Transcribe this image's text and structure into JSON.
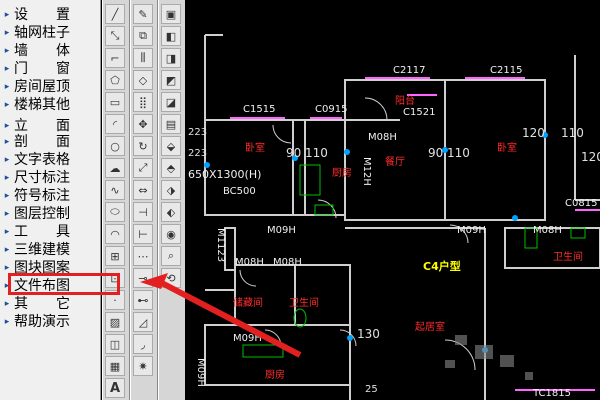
{
  "menu": {
    "items": [
      {
        "label": "设　　置",
        "arrow": "▸"
      },
      {
        "label": "轴网柱子",
        "arrow": "▸"
      },
      {
        "label": "墙　　体",
        "arrow": "▸"
      },
      {
        "label": "门　　窗",
        "arrow": "▸"
      },
      {
        "label": "房间屋顶",
        "arrow": "▸"
      },
      {
        "label": "楼梯其他",
        "arrow": "▸"
      },
      {
        "label": "立　　面",
        "arrow": "▸"
      },
      {
        "label": "剖　　面",
        "arrow": "▸"
      },
      {
        "label": "文字表格",
        "arrow": "▸"
      },
      {
        "label": "尺寸标注",
        "arrow": "▸"
      },
      {
        "label": "符号标注",
        "arrow": "▸"
      },
      {
        "label": "图层控制",
        "arrow": "▸"
      },
      {
        "label": "工　　具",
        "arrow": "▸"
      },
      {
        "label": "三维建模",
        "arrow": "▸"
      },
      {
        "label": "图块图案",
        "arrow": "▸"
      },
      {
        "label": "文件布图",
        "arrow": "▸"
      },
      {
        "label": "其　　它",
        "arrow": "▸"
      },
      {
        "label": "帮助演示",
        "arrow": "▸"
      }
    ],
    "highlight_color": "#e32020"
  },
  "toolbar": {
    "bottom_glyph": "A"
  },
  "drawing": {
    "labels": {
      "c2117": "C2117",
      "c2115": "C2115",
      "c1515": "C1515",
      "c0915": "C0915",
      "c1521": "C1521",
      "c0815": "C0815",
      "tc1815": "TC1815",
      "m08h_1": "M08H",
      "m08h_2": "M08H",
      "m08h_3": "M08H",
      "m08h_4": "M08H",
      "m09h_1": "M09H",
      "m09h_2": "M09H",
      "m09h_3": "M09H",
      "m12h": "M12H",
      "m11123": "M1123",
      "m09h_v": "M09H",
      "bc500": "BC500",
      "win650": "650X1300(H)",
      "n223a": "223",
      "n223b": "223",
      "n90a": "90",
      "n110a": "110",
      "n90b": "90",
      "n110b": "110",
      "n120a": "120",
      "n110c": "110",
      "n120b": "120",
      "n130": "130",
      "n25": "25",
      "room_bedroom1": "卧室",
      "room_bedroom2": "卧室",
      "room_kitchen1": "厨房",
      "room_dining": "餐厅",
      "room_balcony": "阳台",
      "room_storage": "储藏间",
      "room_bath1": "卫生间",
      "room_bath2": "卫生间",
      "room_living": "起居室",
      "room_kitchen2": "厨房",
      "unit_type": "C4户型"
    }
  },
  "colors": {
    "wall": "#cfcfcf",
    "window": "#ff66ff",
    "room_text": "#ff2a2a",
    "unit_text": "#ffff00",
    "axis_marker": "#00a0ff",
    "fixture": "#00c000"
  }
}
